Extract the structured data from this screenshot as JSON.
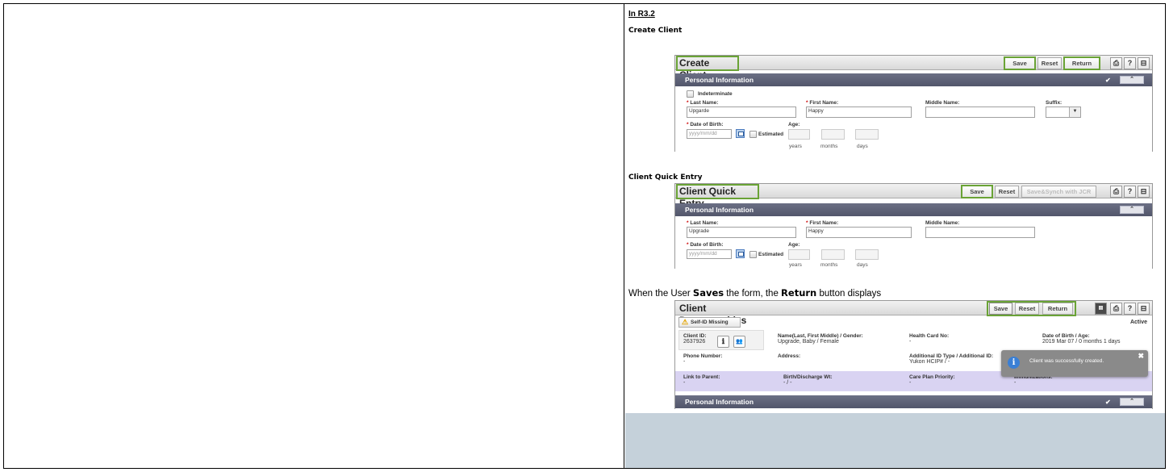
{
  "doc": {
    "heading": "In R3.2",
    "section1": "Create Client",
    "section2": "Client Quick Entry",
    "sentence": {
      "pre": "When the User ",
      "bold1": "Saves",
      "mid": " the form, the ",
      "bold2": "Return",
      "post": " button displays"
    }
  },
  "create_client": {
    "title": "Create Client",
    "buttons": {
      "save": "Save",
      "reset": "Reset",
      "return": "Return"
    },
    "icons": {
      "print": "⎙",
      "help": "?",
      "collapse": "⊟"
    },
    "section": "Personal Information",
    "indeterminate": "Indeterminate",
    "last_name_label": "Last Name:",
    "last_name": "Upgarde",
    "first_name_label": "First Name:",
    "first_name": "Happy",
    "middle_name_label": "Middle Name:",
    "suffix_label": "Suffix:",
    "dob_label": "Date of Birth:",
    "dob_placeholder": "yyyy/mm/dd",
    "estimated": "Estimated",
    "age_label": "Age:",
    "years": "years",
    "months": "months",
    "days": "days"
  },
  "quick_entry": {
    "title": "Client Quick Entry",
    "buttons": {
      "save": "Save",
      "reset": "Reset",
      "save_synch": "Save&Synch with JCR"
    },
    "section": "Personal Information",
    "last_name_label": "Last Name:",
    "last_name": "Upgrade",
    "first_name_label": "First Name:",
    "first_name": "Happy",
    "middle_name_label": "Middle Name:",
    "dob_label": "Date of Birth:",
    "dob_placeholder": "yyyy/mm/dd",
    "estimated": "Estimated",
    "age_label": "Age:",
    "years": "years",
    "months": "months",
    "days": "days"
  },
  "demographics": {
    "title": "Client Demographics",
    "buttons": {
      "save": "Save",
      "reset": "Reset",
      "return": "Return"
    },
    "status": "Active",
    "warning": "Self-ID Missing",
    "client_id_label": "Client ID:",
    "client_id": "2637926",
    "name_label": "Name(Last, First Middle) / Gender:",
    "name": "Upgrade, Baby / Female",
    "hcn_label": "Health Card No:",
    "hcn": "-",
    "dob_label": "Date of Birth / Age:",
    "dob": "2019 Mar 07 / 0 months 1 days",
    "phone_label": "Phone Number:",
    "phone": "-",
    "address_label": "Address:",
    "addl_id_label": "Additional ID Type / Additional ID:",
    "addl_id": "Yukon HCIP# / -",
    "link_parent_label": "Link to Parent:",
    "link_parent": "-",
    "birth_wt_label": "Birth/Discharge Wt:",
    "birth_wt": "- / -",
    "care_plan_label": "Care Plan Priority:",
    "care_plan": "-",
    "immunizations_label": "Immunizations:",
    "immunizations": "-",
    "section": "Personal Information",
    "toast": "Client was successfully created."
  }
}
